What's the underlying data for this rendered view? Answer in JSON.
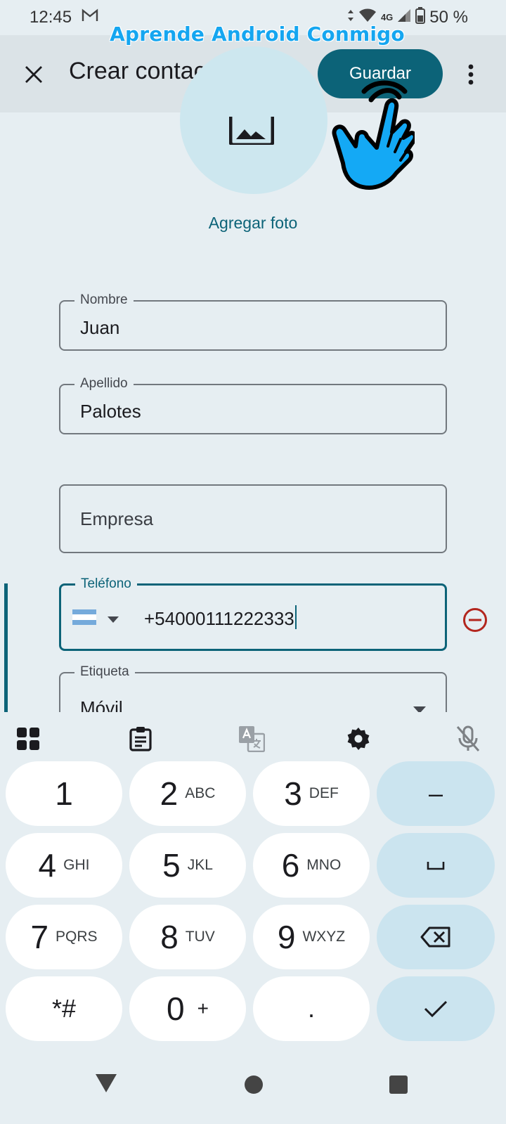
{
  "status_bar": {
    "time": "12:45",
    "network": "4G",
    "battery": "50 %"
  },
  "watermark": "Aprende Android Conmigo",
  "app_bar": {
    "title": "Crear contacto",
    "save_label": "Guardar"
  },
  "photo": {
    "add_label": "Agregar foto"
  },
  "form": {
    "first_name": {
      "label": "Nombre",
      "value": "Juan"
    },
    "last_name": {
      "label": "Apellido",
      "value": "Palotes"
    },
    "company": {
      "placeholder": "Empresa"
    },
    "phone": {
      "label": "Teléfono",
      "value": "+54000111222333",
      "country_flag": "argentina-flag"
    },
    "tag": {
      "label": "Etiqueta",
      "value": "Móvil"
    }
  },
  "keyboard": {
    "keys": [
      {
        "digit": "1",
        "letters": ""
      },
      {
        "digit": "2",
        "letters": "ABC"
      },
      {
        "digit": "3",
        "letters": "DEF"
      },
      {
        "digit": "4",
        "letters": "GHI"
      },
      {
        "digit": "5",
        "letters": "JKL"
      },
      {
        "digit": "6",
        "letters": "MNO"
      },
      {
        "digit": "7",
        "letters": "PQRS"
      },
      {
        "digit": "8",
        "letters": "TUV"
      },
      {
        "digit": "9",
        "letters": "WXYZ"
      },
      {
        "digit": "*#",
        "letters": ""
      },
      {
        "digit": "0",
        "letters": "+"
      },
      {
        "digit": ".",
        "letters": ""
      }
    ],
    "minus_key": "–",
    "icons": [
      "apps-grid-icon",
      "clipboard-icon",
      "translate-icon",
      "settings-icon",
      "mic-off-icon"
    ]
  },
  "colors": {
    "accent": "#0c6378",
    "background": "#e6eef2",
    "app_bar": "#dbe3e7",
    "remove": "#b3261e",
    "watermark": "#15a6f0",
    "hand": "#14a9f5"
  }
}
